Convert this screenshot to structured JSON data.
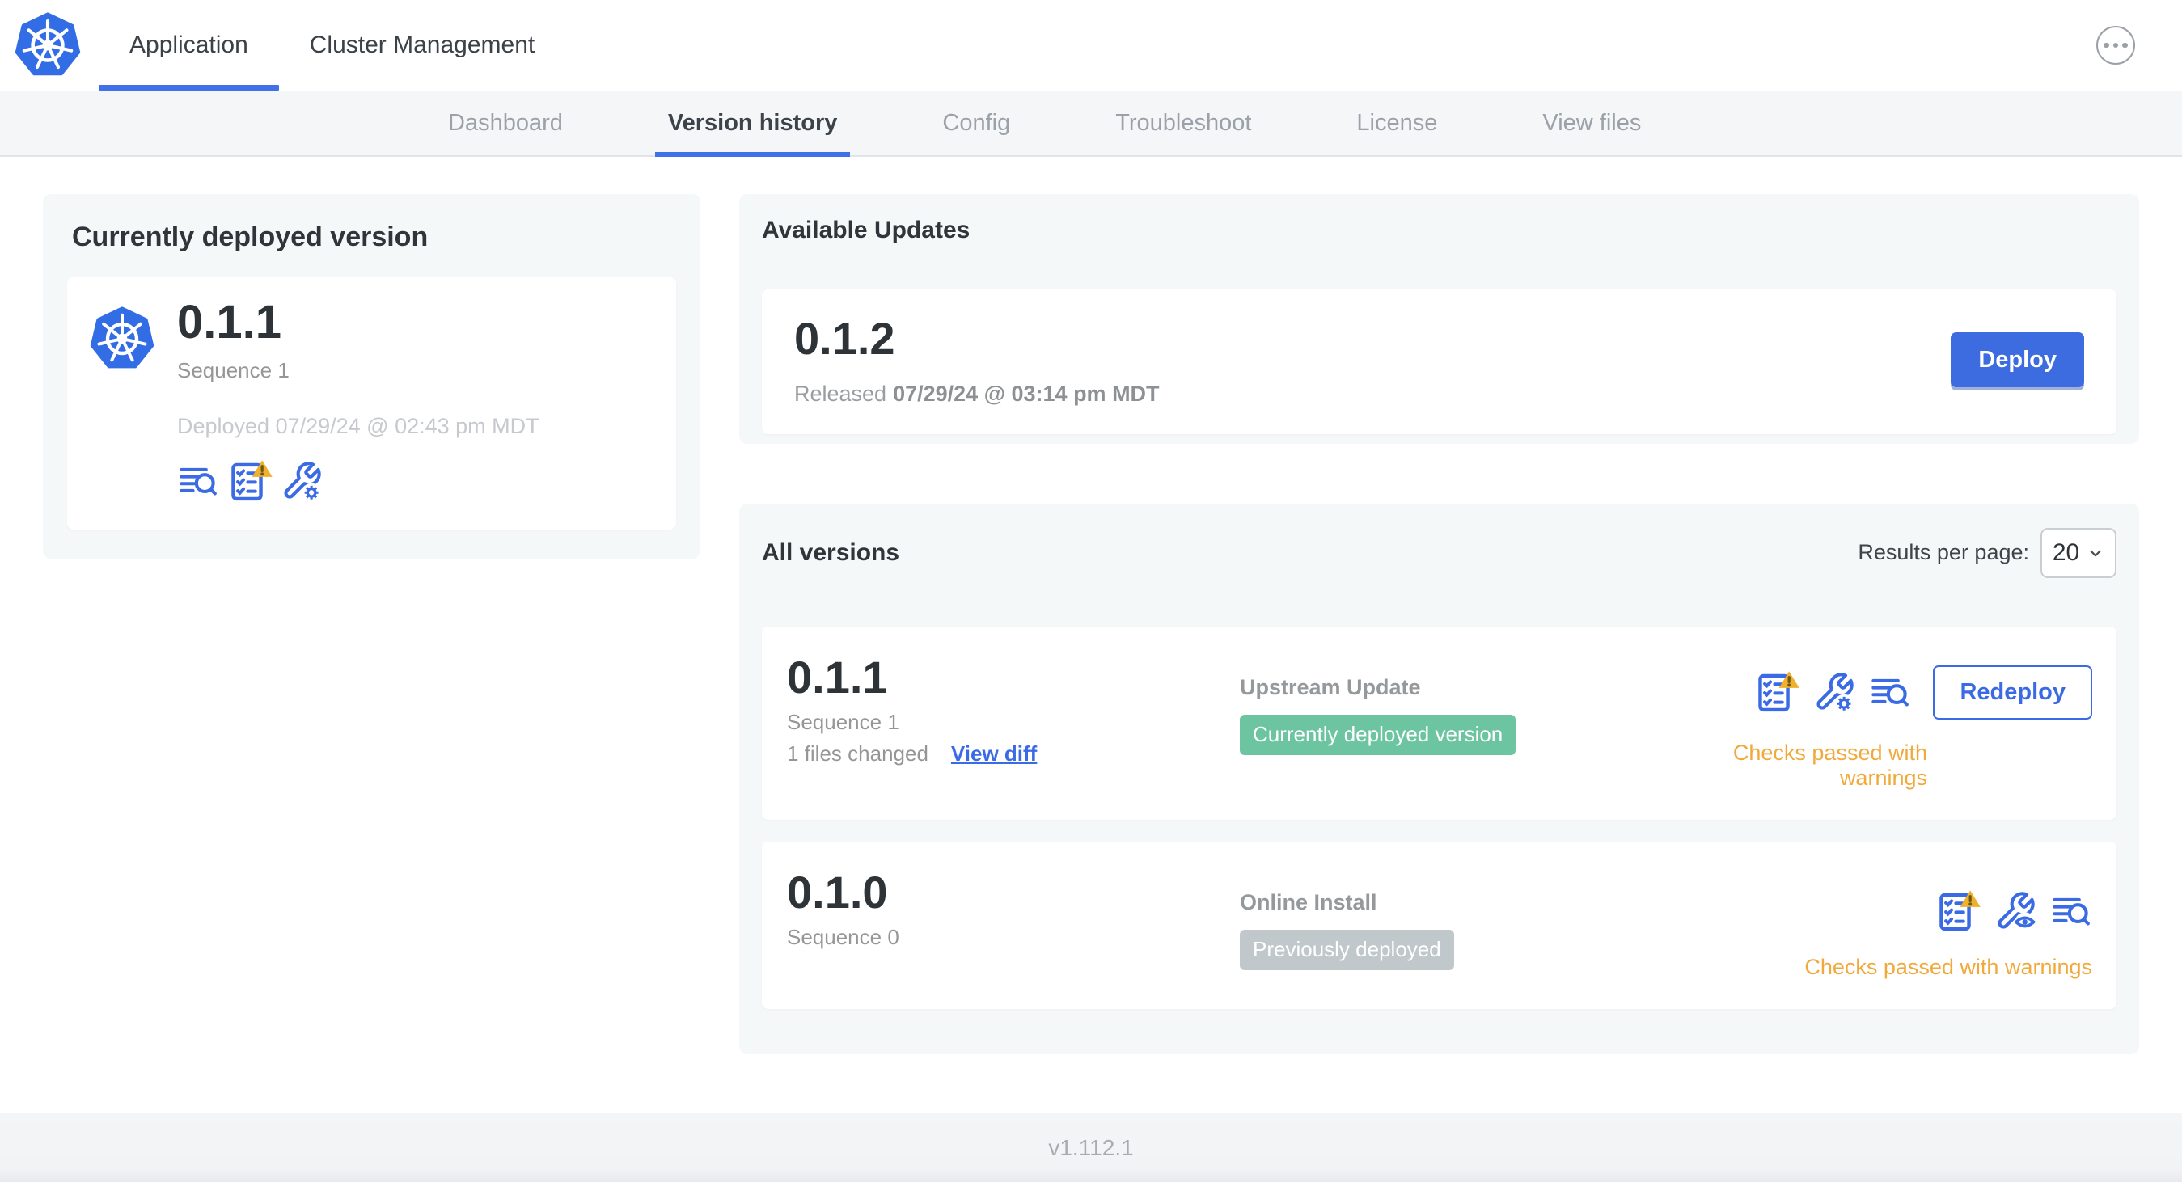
{
  "topbar": {
    "tabs": [
      {
        "label": "Application",
        "active": true
      },
      {
        "label": "Cluster Management",
        "active": false
      }
    ],
    "menu_icon": "ellipsis-icon"
  },
  "subnav": {
    "active_tab": "Version history",
    "tabs": [
      {
        "label": "Dashboard"
      },
      {
        "label": "Version history"
      },
      {
        "label": "Config"
      },
      {
        "label": "Troubleshoot"
      },
      {
        "label": "License"
      },
      {
        "label": "View files"
      }
    ]
  },
  "current_version": {
    "title": "Currently deployed version",
    "version": "0.1.1",
    "sequence": "Sequence 1",
    "deployed": "Deployed 07/29/24 @ 02:43 pm MDT",
    "icons": [
      "view-logs-icon",
      "preflight-checks-warning-icon",
      "edit-config-icon"
    ]
  },
  "available_updates": {
    "title": "Available Updates",
    "version": "0.1.2",
    "released_label": "Released",
    "released_date": "07/29/24 @ 03:14 pm MDT",
    "deploy_button": "Deploy"
  },
  "all_versions": {
    "title": "All versions",
    "results_per_page_label": "Results per page:",
    "results_per_page_value": "20",
    "rows": [
      {
        "version": "0.1.1",
        "sequence": "Sequence 1",
        "files_changed": "1 files changed",
        "view_diff_link": "View diff",
        "source": "Upstream Update",
        "badge": "Currently deployed version",
        "badge_color": "#6cc5a0",
        "icons": [
          "preflight-checks-warning-icon",
          "edit-config-icon",
          "view-logs-icon"
        ],
        "action_button": "Redeploy",
        "status": "Checks passed with warnings"
      },
      {
        "version": "0.1.0",
        "sequence": "Sequence 0",
        "source": "Online Install",
        "badge": "Previously deployed",
        "badge_color": "#c0c8cb",
        "icons": [
          "preflight-checks-warning-icon",
          "view-config-icon",
          "view-logs-icon"
        ],
        "status": "Checks passed with warnings"
      }
    ]
  },
  "footer": {
    "version_label": "v1.112.1"
  },
  "colors": {
    "accent_blue": "#3b6be4",
    "logo_blue": "#326de6",
    "badge_green": "#6cc5a0",
    "badge_gray": "#c0c8cb",
    "warning_orange": "#f0a93a",
    "panel_gray": "#f5f8f9"
  }
}
